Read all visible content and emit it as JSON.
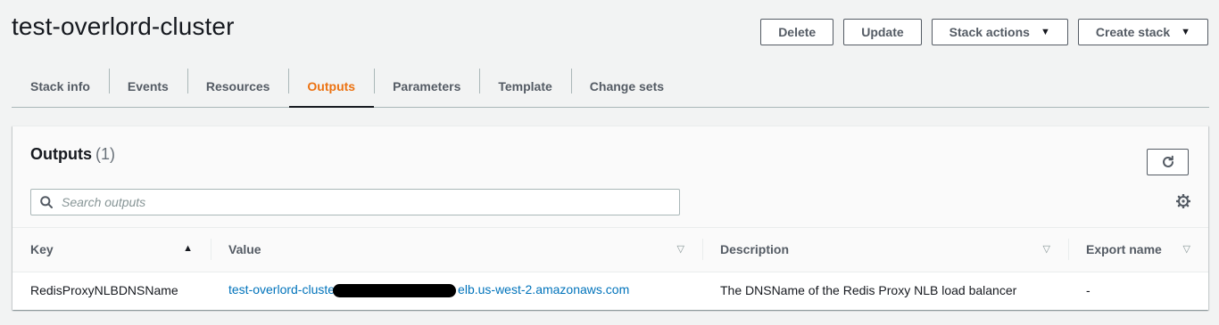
{
  "header": {
    "title": "test-overlord-cluster",
    "actions": [
      {
        "label": "Delete",
        "dropdown": false
      },
      {
        "label": "Update",
        "dropdown": false
      },
      {
        "label": "Stack actions",
        "dropdown": true
      },
      {
        "label": "Create stack",
        "dropdown": true
      }
    ]
  },
  "tabs": {
    "items": [
      "Stack info",
      "Events",
      "Resources",
      "Outputs",
      "Parameters",
      "Template",
      "Change sets"
    ],
    "active": "Outputs"
  },
  "outputs": {
    "title": "Outputs",
    "count": "(1)",
    "search_placeholder": "Search outputs",
    "columns": [
      "Key",
      "Value",
      "Description",
      "Export name"
    ],
    "rows": [
      {
        "key": "RedisProxyNLBDNSName",
        "value_prefix": "test-overlord-cluste",
        "value_suffix": "elb.us-west-2.amazonaws.com",
        "description": "The DNSName of the Redis Proxy NLB load balancer",
        "export_name": "-"
      }
    ]
  },
  "colors": {
    "accent": "#ec7211",
    "link": "#0073bb",
    "text": "#16191f",
    "muted": "#545b64",
    "background": "#f2f3f3"
  },
  "icons": [
    "caret-down-icon",
    "refresh-icon",
    "search-icon",
    "gear-icon",
    "sort-ascending-icon",
    "sort-icon"
  ]
}
